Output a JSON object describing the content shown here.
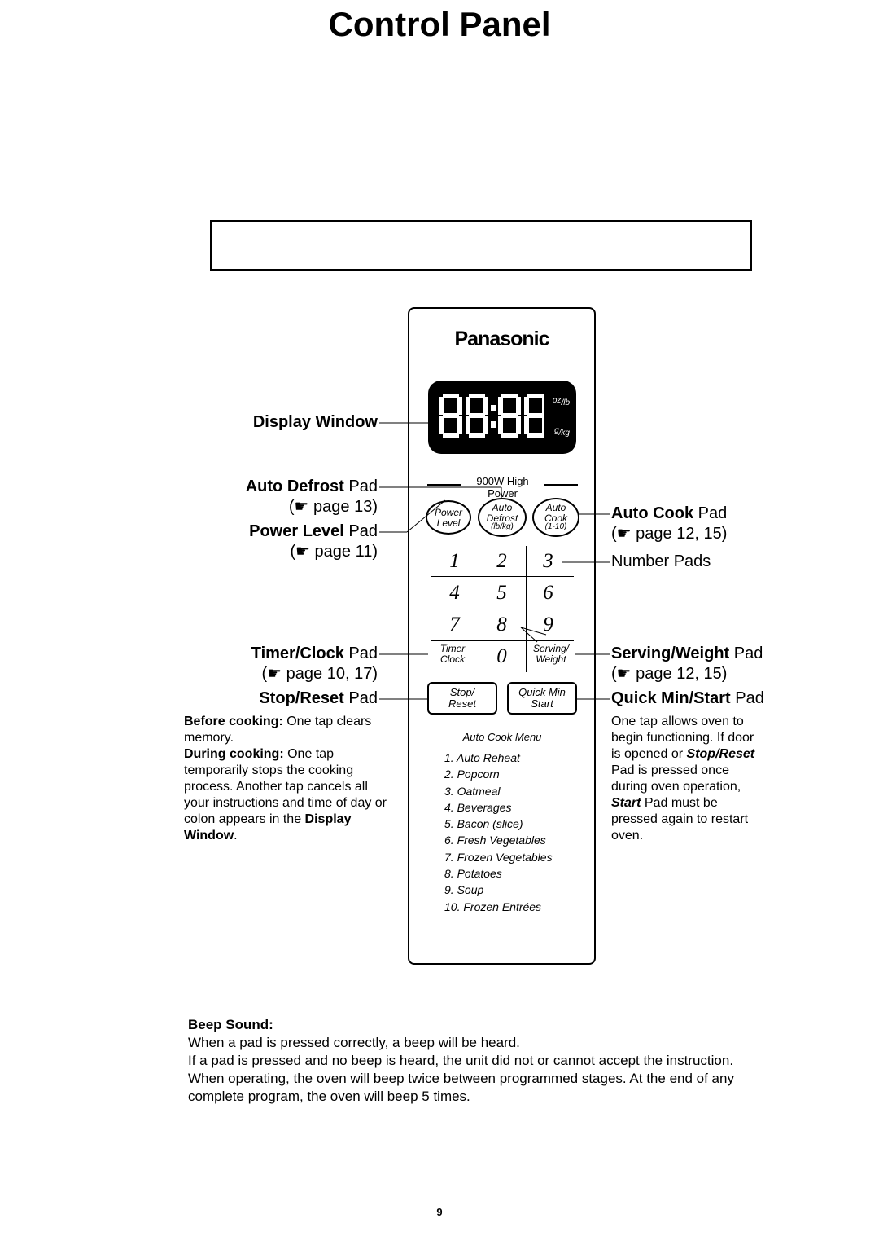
{
  "title": "Control Panel",
  "brand": "Panasonic",
  "display": {
    "segments": "88:88",
    "unit_oz_lb_top": "oz",
    "unit_oz_lb_bot": "/lb",
    "unit_g_kg_top": "g",
    "unit_g_kg_bot": "/kg"
  },
  "hp_label": "900W High Power",
  "pads": {
    "power": {
      "l1": "Power",
      "l2": "Level"
    },
    "defrost": {
      "l1": "Auto",
      "l2": "Defrost",
      "l3": "(lb/kg)"
    },
    "cook": {
      "l1": "Auto",
      "l2": "Cook",
      "l3": "(1-10)"
    },
    "timer": {
      "l1": "Timer",
      "l2": "Clock"
    },
    "serving": {
      "l1": "Serving/",
      "l2": "Weight"
    },
    "stop": {
      "l1": "Stop/",
      "l2": "Reset"
    },
    "start": {
      "l1": "Quick Min",
      "l2": "Start"
    }
  },
  "numbers": {
    "n1": "1",
    "n2": "2",
    "n3": "3",
    "n4": "4",
    "n5": "5",
    "n6": "6",
    "n7": "7",
    "n8": "8",
    "n9": "9",
    "n0": "0"
  },
  "autocook_header": "Auto Cook Menu",
  "autocook_list": [
    "1.  Auto Reheat",
    "2.  Popcorn",
    "3.  Oatmeal",
    "4.  Beverages",
    "5.  Bacon (slice)",
    "6.  Fresh Vegetables",
    "7.  Frozen Vegetables",
    "8.  Potatoes",
    "9.  Soup",
    "10.  Frozen Entrées"
  ],
  "callouts": {
    "display": {
      "label": "Display Window"
    },
    "autodefrost": {
      "label_bold": "Auto Defrost ",
      "label_rest": "Pad",
      "ref": "(☛ page 13)"
    },
    "power": {
      "label_bold": "Power Level ",
      "label_rest": "Pad",
      "ref": "(☛ page 11)"
    },
    "timer": {
      "label_bold": "Timer/Clock ",
      "label_rest": "Pad",
      "ref": "(☛ page 10, 17)"
    },
    "stop": {
      "label_bold": "Stop/Reset ",
      "label_rest": "Pad",
      "before_lead": "Before cooking: ",
      "before_body": "One tap clears memory.",
      "during_lead": "During cooking: ",
      "during_body_1": "One tap temporarily stops the cooking process. Another tap cancels all your instructions and time of day or colon appears in the ",
      "display_window": "Display Window",
      "period": "."
    },
    "autocook": {
      "label_bold": "Auto Cook ",
      "label_rest": "Pad",
      "ref": "(☛ page 12, 15)"
    },
    "number": {
      "label": "Number Pads"
    },
    "serving": {
      "label_bold": "Serving/Weight ",
      "label_rest": "Pad",
      "ref": "(☛ page 12, 15)"
    },
    "quick": {
      "label_bold": "Quick Min/Start ",
      "label_rest": "Pad",
      "body_1": "One tap allows oven to begin functioning. If door is opened or ",
      "stop_reset": "Stop/Reset",
      "body_2": " Pad is pressed once during oven operation, ",
      "start": "Start",
      "body_3": " Pad must be pressed again to restart oven."
    }
  },
  "beep": {
    "heading": "Beep Sound:",
    "l1": "When a pad is pressed correctly, a beep will be heard.",
    "l2": "If a pad is pressed and no beep is heard, the unit did not or cannot accept the instruction.",
    "l3": "When operating, the oven will beep twice between programmed stages. At the end of any complete program, the oven will beep 5 times."
  },
  "page_number": "9"
}
